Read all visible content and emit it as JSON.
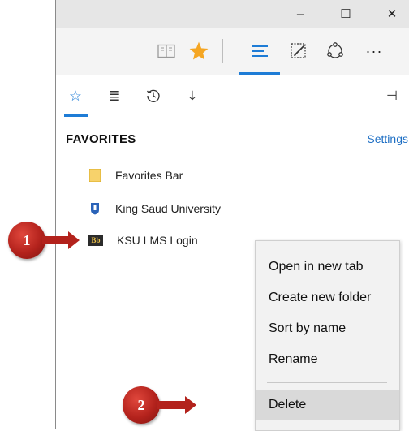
{
  "window_controls": {
    "minimize": "–",
    "maximize": "☐",
    "close": "✕"
  },
  "toolbar": {
    "reading_view_icon": "book-icon",
    "favorite_star_icon": "star-icon",
    "hub_icon": "hub-lines-icon",
    "web_note_icon": "web-note-icon",
    "share_icon": "share-icon",
    "more_label": "···",
    "star_color": "#f5a623",
    "accent_color": "#1e7cd6"
  },
  "hub_tabs": [
    {
      "name": "favorites",
      "glyph": "☆"
    },
    {
      "name": "reading-list",
      "glyph": "≣"
    },
    {
      "name": "history",
      "glyph": "🕔"
    },
    {
      "name": "downloads",
      "glyph": "⤓"
    }
  ],
  "pin_glyph": "⊣",
  "favorites": {
    "header": "FAVORITES",
    "settings_label": "Settings",
    "items": [
      {
        "label": "Favorites Bar",
        "icon": "folder-icon"
      },
      {
        "label": "King Saud University",
        "icon": "ksu-shield-icon"
      },
      {
        "label": "KSU LMS Login",
        "icon": "blackboard-icon",
        "icon_text": "Bb"
      }
    ]
  },
  "context_menu": {
    "items": [
      "Open in new tab",
      "Create new folder",
      "Sort by name",
      "Rename",
      "Delete"
    ],
    "highlighted": "Delete"
  },
  "callouts": [
    "1",
    "2"
  ],
  "callout_color": "#b3221c"
}
